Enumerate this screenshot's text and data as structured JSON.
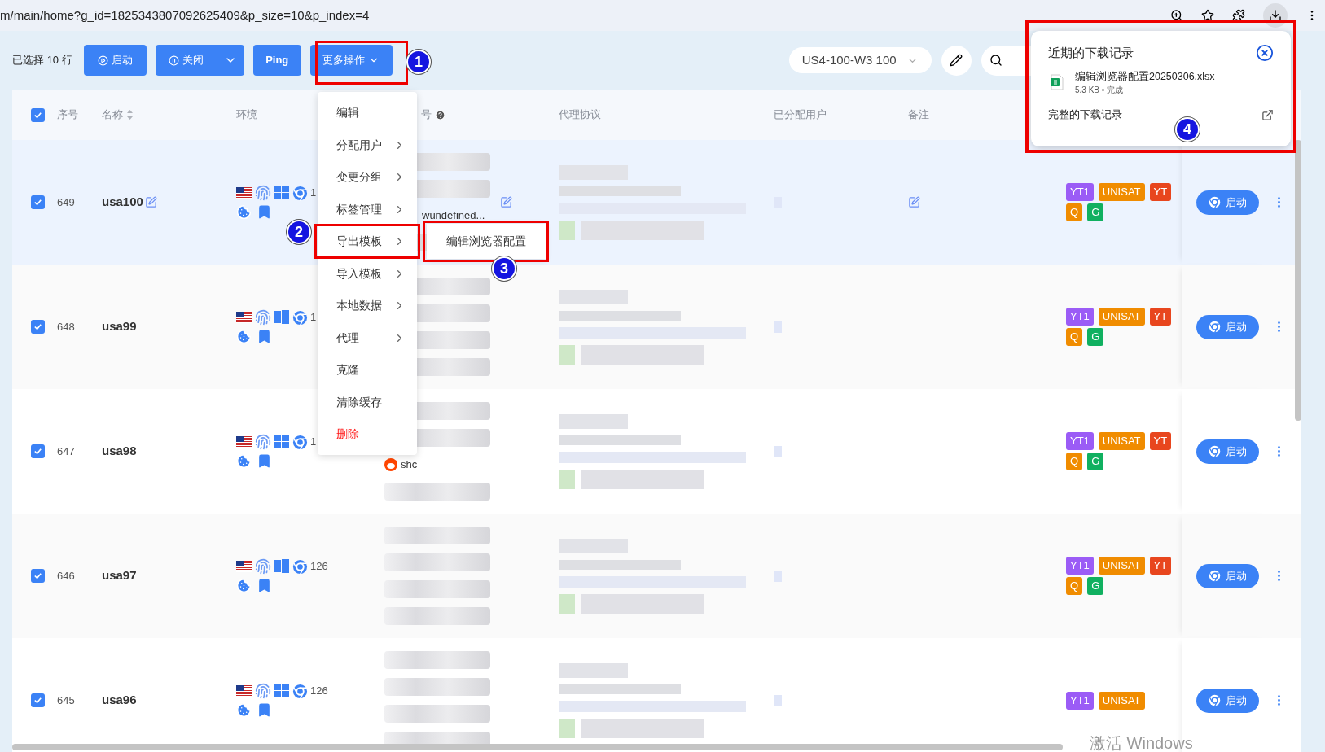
{
  "browser": {
    "url": "m/main/home?g_id=1825343807092625409&p_size=10&p_index=4"
  },
  "toolbar": {
    "selection_label": "已选择",
    "selection_count": "10",
    "selection_unit": "行",
    "buttons": [
      {
        "label": "启动",
        "kind": "start"
      },
      {
        "label": "关闭",
        "kind": "split"
      },
      {
        "label": "Ping",
        "kind": "plain"
      },
      {
        "label": "更多操作",
        "kind": "menu"
      }
    ],
    "group_select": {
      "value": "US4-100-W3 100"
    }
  },
  "table": {
    "all_checked": true,
    "columns": [
      {
        "label": "序号",
        "kind": "plain"
      },
      {
        "label": "名称",
        "kind": "sortable"
      },
      {
        "label": "环境",
        "kind": "plain"
      },
      {
        "label": "号",
        "kind": "help"
      },
      {
        "label": "代理协议",
        "kind": "plain"
      },
      {
        "label": "已分配用户",
        "kind": "plain"
      },
      {
        "label": "备注",
        "kind": "plain"
      }
    ],
    "rows": [
      {
        "checked": true,
        "index": "649",
        "name": "usa100",
        "highlighted": true,
        "show_edit": true,
        "env_version": "1",
        "account_lines": [
          {
            "kind": "blurred"
          },
          {
            "kind": "blurred"
          },
          {
            "kind": "text",
            "text": "wundefined..."
          },
          {
            "kind": "blurred"
          }
        ],
        "tags": [
          {
            "label": "YT1",
            "color": "#9b5cf6"
          },
          {
            "label": "UNISAT",
            "color": "#f08c00"
          },
          {
            "label": "YT",
            "color": "#e8461e"
          },
          {
            "label": "Q",
            "color": "#f08c00"
          },
          {
            "label": "G",
            "color": "#10b060"
          }
        ],
        "launch_label": "启动"
      },
      {
        "checked": true,
        "index": "648",
        "name": "usa99",
        "highlighted": false,
        "show_edit": false,
        "env_version": "1",
        "account_lines": [
          {
            "kind": "blurred"
          },
          {
            "kind": "blurred"
          },
          {
            "kind": "blurred"
          },
          {
            "kind": "blurred"
          }
        ],
        "tags": [
          {
            "label": "YT1",
            "color": "#9b5cf6"
          },
          {
            "label": "UNISAT",
            "color": "#f08c00"
          },
          {
            "label": "YT",
            "color": "#e8461e"
          },
          {
            "label": "Q",
            "color": "#f08c00"
          },
          {
            "label": "G",
            "color": "#10b060"
          }
        ],
        "launch_label": "启动"
      },
      {
        "checked": true,
        "index": "647",
        "name": "usa98",
        "highlighted": false,
        "show_edit": false,
        "env_version": "1",
        "account_lines": [
          {
            "kind": "blurred"
          },
          {
            "kind": "blurred"
          },
          {
            "kind": "site",
            "text": "shc"
          },
          {
            "kind": "blurred"
          }
        ],
        "tags": [
          {
            "label": "YT1",
            "color": "#9b5cf6"
          },
          {
            "label": "UNISAT",
            "color": "#f08c00"
          },
          {
            "label": "YT",
            "color": "#e8461e"
          },
          {
            "label": "Q",
            "color": "#f08c00"
          },
          {
            "label": "G",
            "color": "#10b060"
          }
        ],
        "launch_label": "启动"
      },
      {
        "checked": true,
        "index": "646",
        "name": "usa97",
        "highlighted": false,
        "show_edit": false,
        "env_version": "126",
        "account_lines": [
          {
            "kind": "blurred"
          },
          {
            "kind": "blurred"
          },
          {
            "kind": "blurred"
          },
          {
            "kind": "blurred"
          }
        ],
        "tags": [
          {
            "label": "YT1",
            "color": "#9b5cf6"
          },
          {
            "label": "UNISAT",
            "color": "#f08c00"
          },
          {
            "label": "YT",
            "color": "#e8461e"
          },
          {
            "label": "Q",
            "color": "#f08c00"
          },
          {
            "label": "G",
            "color": "#10b060"
          }
        ],
        "launch_label": "启动"
      },
      {
        "checked": true,
        "index": "645",
        "name": "usa96",
        "highlighted": false,
        "show_edit": false,
        "env_version": "126",
        "account_lines": [
          {
            "kind": "blurred"
          },
          {
            "kind": "blurred"
          },
          {
            "kind": "blurred"
          },
          {
            "kind": "blurred"
          }
        ],
        "tags": [
          {
            "label": "YT1",
            "color": "#9b5cf6"
          },
          {
            "label": "UNISAT",
            "color": "#f08c00"
          }
        ],
        "launch_label": "启动"
      }
    ]
  },
  "context_menu": {
    "items": [
      {
        "label": "编辑",
        "kind": "normal"
      },
      {
        "label": "分配用户",
        "kind": "submenu"
      },
      {
        "label": "变更分组",
        "kind": "submenu"
      },
      {
        "label": "标签管理",
        "kind": "submenu"
      },
      {
        "label": "导出模板",
        "kind": "submenu"
      },
      {
        "label": "导入模板",
        "kind": "submenu"
      },
      {
        "label": "本地数据",
        "kind": "submenu"
      },
      {
        "label": "代理",
        "kind": "submenu"
      },
      {
        "label": "克隆",
        "kind": "normal"
      },
      {
        "label": "清除缓存",
        "kind": "normal"
      },
      {
        "label": "删除",
        "kind": "danger"
      }
    ],
    "submenu": {
      "items": [
        {
          "label": "编辑浏览器配置"
        }
      ]
    }
  },
  "downloads": {
    "title": "近期的下载记录",
    "file": {
      "name": "编辑浏览器配置20250306.xlsx",
      "meta": "5.3 KB • 完成"
    },
    "footer": "完整的下载记录"
  },
  "annotations": [
    {
      "label": "1"
    },
    {
      "label": "2"
    },
    {
      "label": "3"
    },
    {
      "label": "4"
    }
  ],
  "os_overlay": "激活 Windows"
}
